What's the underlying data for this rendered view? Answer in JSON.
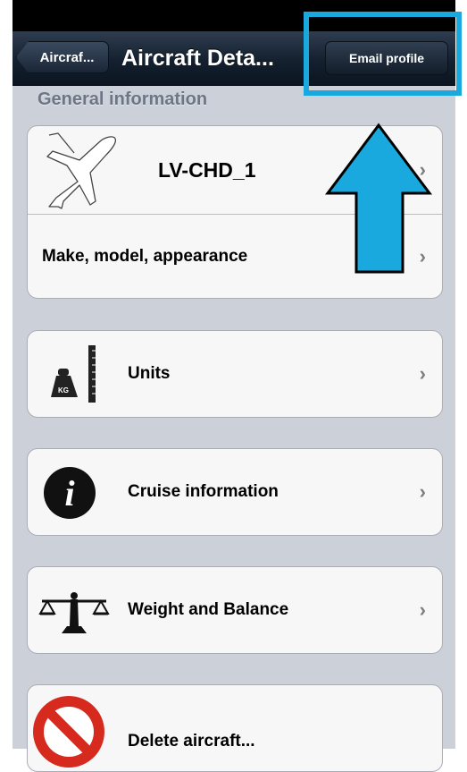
{
  "navbar": {
    "back_label": "Aircraf...",
    "title": "Aircraft Deta...",
    "email_label": "Email profile"
  },
  "section": {
    "header": "General information"
  },
  "rows": {
    "aircraft_name": "LV-CHD_1",
    "make_model": "Make, model, appearance",
    "units": "Units",
    "cruise": "Cruise information",
    "weight_balance": "Weight and Balance",
    "delete": "Delete aircraft..."
  },
  "icons": {
    "units": "scale-weight-kg-icon",
    "units_badge": "KG",
    "cruise": "info-icon",
    "cruise_glyph": "i",
    "weight_balance": "balance-scale-icon",
    "delete": "prohibited-icon",
    "aircraft": "airplane-outline-icon"
  },
  "chevron": "›",
  "colors": {
    "navbar": "#1a2738",
    "background": "#ccd0d8",
    "cell": "#f7f7f7",
    "annotation": "#1aa9de",
    "delete_red": "#d62a1e"
  }
}
